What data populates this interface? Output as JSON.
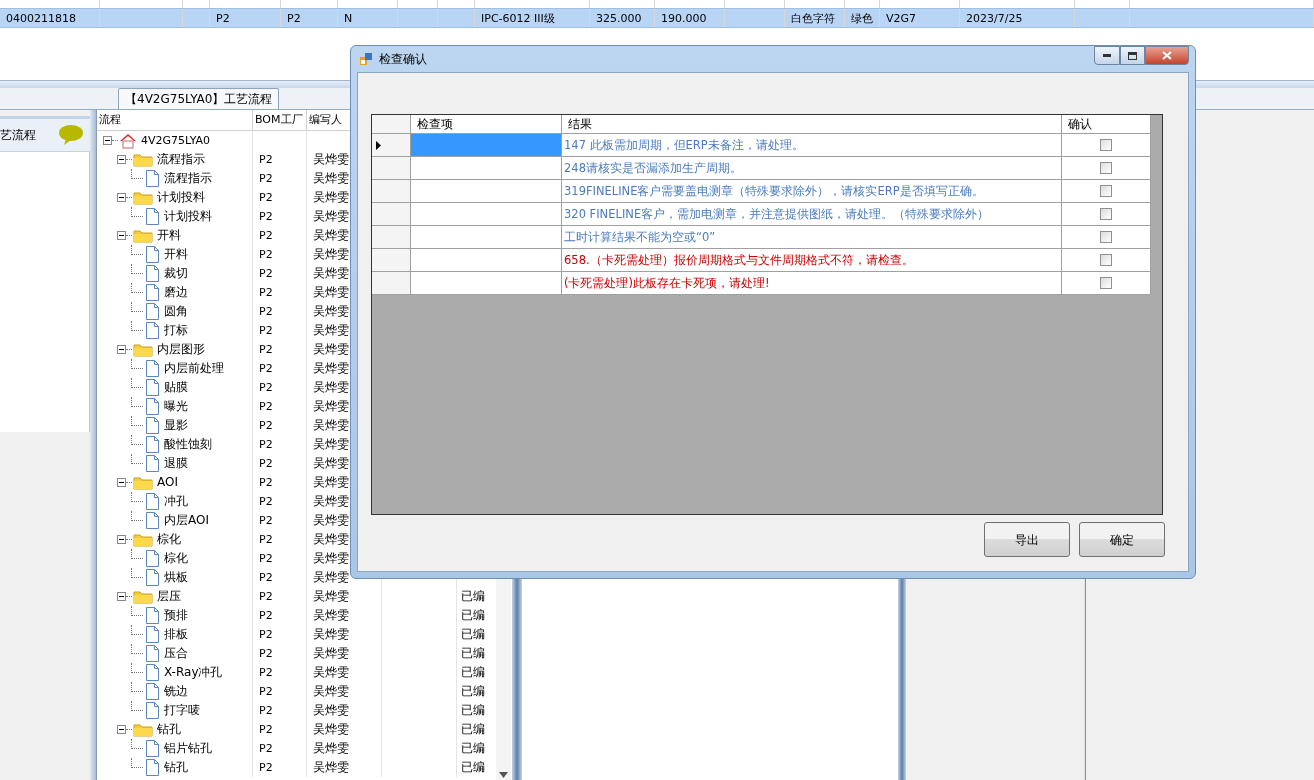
{
  "top_grid": {
    "row": {
      "selected": true,
      "cells": [
        "0400211818",
        "P2",
        "P2",
        "N",
        "IPC-6012 III级",
        "325.000",
        "190.000",
        "白色字符",
        "绿色",
        "V2G7",
        "2023/7/25"
      ]
    }
  },
  "tab": {
    "label": "【4V2G75LYA0】工艺流程"
  },
  "side_panel": {
    "title": "艺流程"
  },
  "tree": {
    "columns": [
      "流程",
      "BOM工厂",
      "编写人"
    ],
    "nodes": [
      {
        "label": "4V2G75LYA0",
        "kind": "root",
        "expanded": true,
        "children": [
          {
            "label": "流程指示",
            "kind": "folder",
            "factory": "P2",
            "author": "吴烨雯",
            "expanded": true,
            "children": [
              {
                "label": "流程指示",
                "kind": "leaf",
                "factory": "P2",
                "author": "吴烨雯"
              }
            ]
          },
          {
            "label": "计划投料",
            "kind": "folder",
            "factory": "P2",
            "author": "吴烨雯",
            "expanded": true,
            "children": [
              {
                "label": "计划投料",
                "kind": "leaf",
                "factory": "P2",
                "author": "吴烨雯"
              }
            ]
          },
          {
            "label": "开料",
            "kind": "folder",
            "factory": "P2",
            "author": "吴烨雯",
            "expanded": true,
            "children": [
              {
                "label": "开料",
                "kind": "leaf",
                "factory": "P2",
                "author": "吴烨雯"
              },
              {
                "label": "裁切",
                "kind": "leaf",
                "factory": "P2",
                "author": "吴烨雯"
              },
              {
                "label": "磨边",
                "kind": "leaf",
                "factory": "P2",
                "author": "吴烨雯"
              },
              {
                "label": "圆角",
                "kind": "leaf",
                "factory": "P2",
                "author": "吴烨雯"
              },
              {
                "label": "打标",
                "kind": "leaf",
                "factory": "P2",
                "author": "吴烨雯"
              }
            ]
          },
          {
            "label": "内层图形",
            "kind": "folder",
            "factory": "P2",
            "author": "吴烨雯",
            "expanded": true,
            "children": [
              {
                "label": "内层前处理",
                "kind": "leaf",
                "factory": "P2",
                "author": "吴烨雯"
              },
              {
                "label": "贴膜",
                "kind": "leaf",
                "factory": "P2",
                "author": "吴烨雯"
              },
              {
                "label": "曝光",
                "kind": "leaf",
                "factory": "P2",
                "author": "吴烨雯"
              },
              {
                "label": "显影",
                "kind": "leaf",
                "factory": "P2",
                "author": "吴烨雯"
              },
              {
                "label": "酸性蚀刻",
                "kind": "leaf",
                "factory": "P2",
                "author": "吴烨雯"
              },
              {
                "label": "退膜",
                "kind": "leaf",
                "factory": "P2",
                "author": "吴烨雯"
              }
            ]
          },
          {
            "label": "AOI",
            "kind": "folder",
            "factory": "P2",
            "author": "吴烨雯",
            "expanded": true,
            "children": [
              {
                "label": "冲孔",
                "kind": "leaf",
                "factory": "P2",
                "author": "吴烨雯"
              },
              {
                "label": "内层AOI",
                "kind": "leaf",
                "factory": "P2",
                "author": "吴烨雯"
              }
            ]
          },
          {
            "label": "棕化",
            "kind": "folder",
            "factory": "P2",
            "author": "吴烨雯",
            "expanded": true,
            "children": [
              {
                "label": "棕化",
                "kind": "leaf",
                "factory": "P2",
                "author": "吴烨雯"
              },
              {
                "label": "烘板",
                "kind": "leaf",
                "factory": "P2",
                "author": "吴烨雯"
              }
            ]
          },
          {
            "label": "层压",
            "kind": "folder",
            "factory": "P2",
            "author": "吴烨雯",
            "status": "已编",
            "expanded": true,
            "children": [
              {
                "label": "预排",
                "kind": "leaf",
                "factory": "P2",
                "author": "吴烨雯",
                "status": "已编"
              },
              {
                "label": "排板",
                "kind": "leaf",
                "factory": "P2",
                "author": "吴烨雯",
                "status": "已编"
              },
              {
                "label": "压合",
                "kind": "leaf",
                "factory": "P2",
                "author": "吴烨雯",
                "status": "已编"
              },
              {
                "label": "X-Ray冲孔",
                "kind": "leaf",
                "factory": "P2",
                "author": "吴烨雯",
                "status": "已编"
              },
              {
                "label": "铣边",
                "kind": "leaf",
                "factory": "P2",
                "author": "吴烨雯",
                "status": "已编"
              },
              {
                "label": "打字唛",
                "kind": "leaf",
                "factory": "P2",
                "author": "吴烨雯",
                "status": "已编"
              }
            ]
          },
          {
            "label": "钻孔",
            "kind": "folder",
            "factory": "P2",
            "author": "吴烨雯",
            "status": "已编",
            "expanded": true,
            "children": [
              {
                "label": "铝片钻孔",
                "kind": "leaf",
                "factory": "P2",
                "author": "吴烨雯",
                "status": "已编"
              },
              {
                "label": "钻孔",
                "kind": "leaf",
                "factory": "P2",
                "author": "吴烨雯",
                "status": "已编"
              }
            ]
          }
        ]
      }
    ]
  },
  "dialog": {
    "title": "检查确认",
    "columns": [
      "检查项",
      "结果",
      "确认"
    ],
    "rows": [
      {
        "selected": true,
        "result": "147 此板需加周期，但ERP未备注，请处理。",
        "color": "#4a7bbf",
        "checked": false
      },
      {
        "selected": false,
        "result": "248请核实是否漏添加生产周期。",
        "color": "#4a7bbf",
        "checked": false
      },
      {
        "selected": false,
        "result": "319FINELINE客户需要盖电测章（特殊要求除外），请核实ERP是否填写正确。",
        "color": "#4a7bbf",
        "checked": false
      },
      {
        "selected": false,
        "result": "320 FINELINE客户，需加电测章，并注意提供图纸，请处理。（特殊要求除外）",
        "color": "#4a7bbf",
        "checked": false
      },
      {
        "selected": false,
        "result": "工时计算结果不能为空或“0”",
        "color": "#4a7bbf",
        "checked": false
      },
      {
        "selected": false,
        "result": "658.（卡死需处理）报价周期格式与文件周期格式不符，请检查。",
        "color": "#cc0000",
        "checked": false
      },
      {
        "selected": false,
        "result": "(卡死需处理)此板存在卡死项，请处理!",
        "color": "#cc0000",
        "checked": false
      }
    ],
    "buttons": [
      "导出",
      "确定"
    ]
  }
}
